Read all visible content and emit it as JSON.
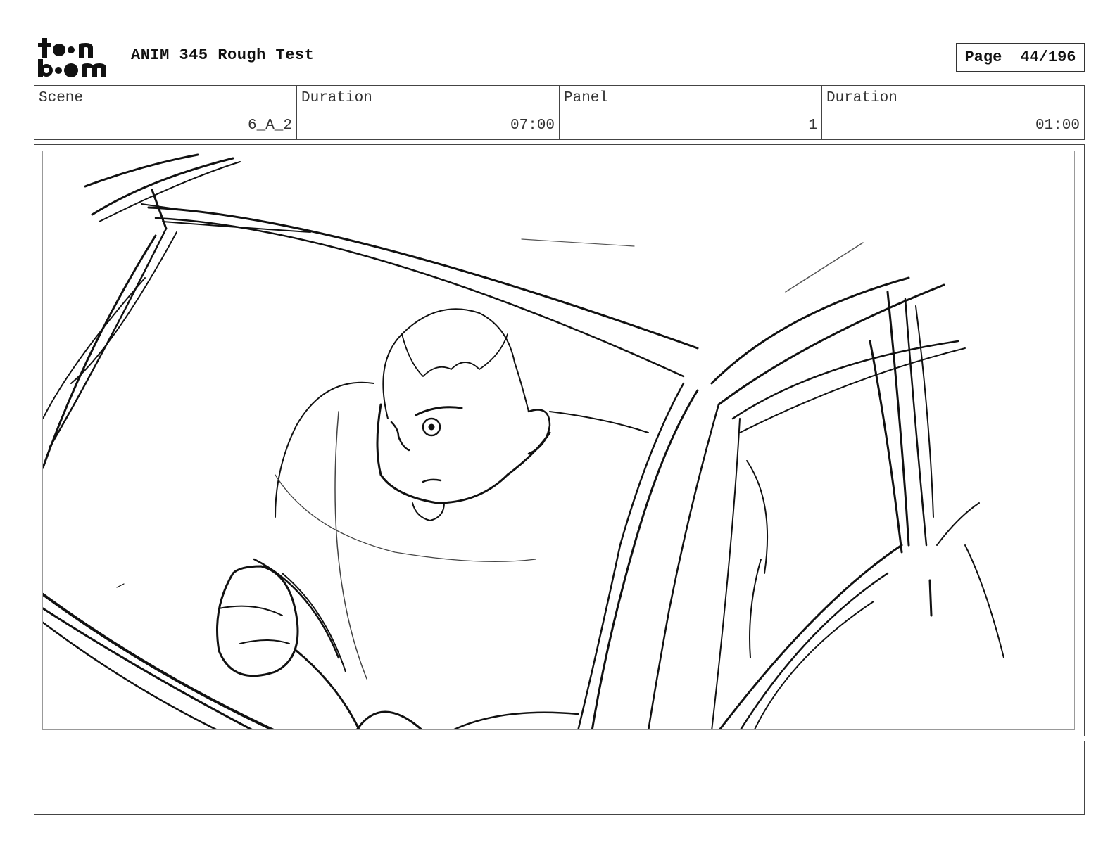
{
  "header": {
    "logo_text_top": "toon",
    "logo_text_bottom": "boom",
    "title": "ANIM 345 Rough Test",
    "page_label": "Page",
    "page_value": "44/196"
  },
  "info": [
    {
      "label": "Scene",
      "value": "6_A_2"
    },
    {
      "label": "Duration",
      "value": "07:00"
    },
    {
      "label": "Panel",
      "value": "1"
    },
    {
      "label": "Duration",
      "value": "01:00"
    }
  ],
  "notes": {
    "text": ""
  }
}
